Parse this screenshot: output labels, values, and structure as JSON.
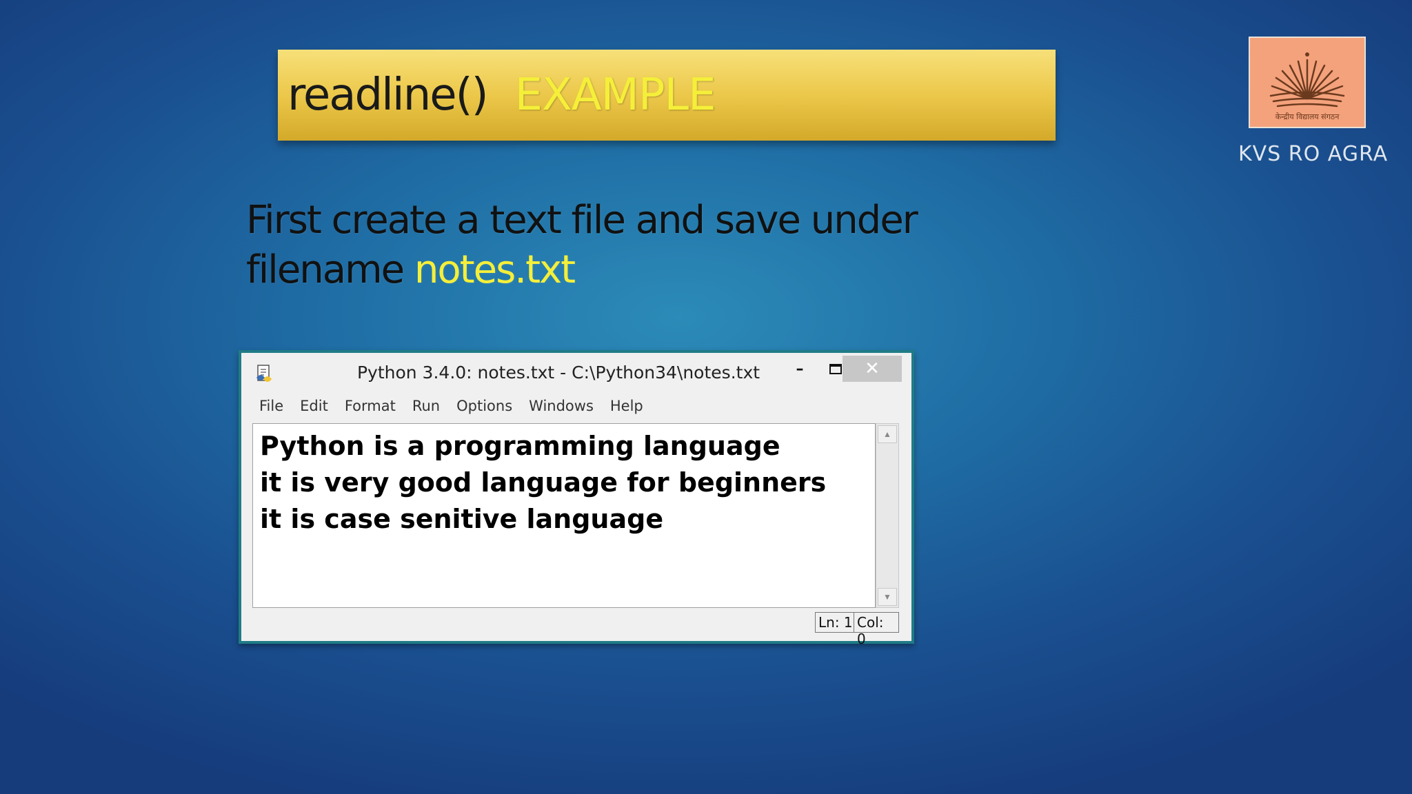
{
  "slide": {
    "title_main": "readline()",
    "title_accent": "EXAMPLE",
    "instruction_line1": "First create a text file and save under",
    "instruction_line2_prefix": "filename",
    "instruction_filename": "notes.txt",
    "logo_caption": "KVS RO AGRA",
    "logo_text": "केन्द्रीय विद्यालय संगठन"
  },
  "window": {
    "title": "Python 3.4.0: notes.txt - C:\\Python34\\notes.txt",
    "menu": [
      "File",
      "Edit",
      "Format",
      "Run",
      "Options",
      "Windows",
      "Help"
    ],
    "lines": [
      "Python is a programming language",
      "it is very good language for beginners",
      "it is case senitive language"
    ],
    "status_ln": "Ln: 1",
    "status_col": "Col: 0"
  },
  "icons": {
    "minimize": "minimize-icon",
    "maximize": "maximize-icon",
    "close": "close-icon",
    "app": "idle-app-icon"
  },
  "colors": {
    "title_banner": "#ecc84a",
    "accent_yellow": "#f5ef3a",
    "window_border": "#1f7c86",
    "logo_bg": "#f4a27c"
  }
}
